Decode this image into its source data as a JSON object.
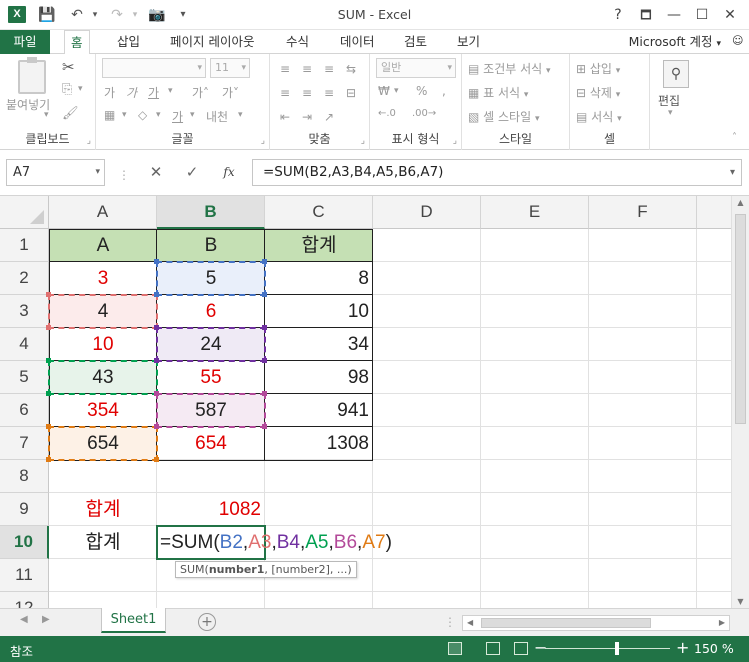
{
  "window": {
    "title": "SUM - Excel",
    "app_icon": "X",
    "help": "?",
    "restore_ribbon": "🗖",
    "minimize": "—",
    "maximize": "☐",
    "close": "✕"
  },
  "quick_access": {
    "save_icon": "save-icon",
    "undo_icon": "undo-icon",
    "redo_icon": "redo-icon",
    "camera_icon": "camera-icon",
    "customize": "▾"
  },
  "tabs": {
    "file": "파일",
    "home": "홈",
    "insert": "삽입",
    "page_layout": "페이지 레이아웃",
    "formulas": "수식",
    "data": "데이터",
    "review": "검토",
    "view": "보기",
    "account": "Microsoft 계정"
  },
  "ribbon": {
    "clipboard": {
      "label": "클립보드",
      "paste": "붙여넣기",
      "cut_icon": "scissors-icon",
      "copy_icon": "copy-icon",
      "format_painter_icon": "brush-icon"
    },
    "font": {
      "label": "글꼴",
      "font_name": "",
      "font_size": "11",
      "grow": "가˄",
      "shrink": "가˅",
      "bold": "가",
      "italic": "가",
      "underline": "가",
      "borders": "▦",
      "fill": "◇",
      "font_color": "가"
    },
    "alignment": {
      "label": "맞춤",
      "wrap": "내청",
      "align_marks": [
        "≡",
        "≡",
        "≡",
        "⇆"
      ]
    },
    "number": {
      "label": "표시 형식",
      "format": "일반",
      "currency": "₩",
      "percent": "%",
      "comma": ",",
      "inc_dec": ".00→.0",
      "dec_dec": ".0→.00"
    },
    "styles": {
      "label": "스타일",
      "conditional": "조건부 서식",
      "table": "표 서식",
      "cell": "셀 스타일"
    },
    "cells": {
      "label": "셀",
      "insert": "삽입",
      "delete": "삭제",
      "format": "서식"
    },
    "editing": {
      "label": "편집"
    }
  },
  "formula_bar": {
    "name_box": "A7",
    "cancel": "✕",
    "enter": "✓",
    "fx": "fx",
    "formula": "=SUM(B2,A3,B4,A5,B6,A7)"
  },
  "columns": [
    "A",
    "B",
    "C",
    "D",
    "E",
    "F"
  ],
  "rows": [
    "1",
    "2",
    "3",
    "4",
    "5",
    "6",
    "7",
    "8",
    "9",
    "10",
    "11",
    "12"
  ],
  "table": {
    "header": [
      "A",
      "B",
      "합계"
    ],
    "rows": [
      [
        "3",
        "5",
        "8"
      ],
      [
        "4",
        "6",
        "10"
      ],
      [
        "10",
        "24",
        "34"
      ],
      [
        "43",
        "55",
        "98"
      ],
      [
        "354",
        "587",
        "941"
      ],
      [
        "654",
        "654",
        "1308"
      ]
    ]
  },
  "row9": {
    "label": "합계",
    "value": "1082"
  },
  "row10": {
    "label": "합계",
    "formula_prefix": "=SUM(",
    "refs": [
      "B2",
      "A3",
      "B4",
      "A5",
      "B6",
      "A7"
    ],
    "separator": ",",
    "close": ")"
  },
  "tooltip": {
    "fn": "SUM(",
    "arg1": "number1",
    "rest": ", [number2], ...)"
  },
  "sheet": {
    "tab": "Sheet1",
    "add": "+",
    "nav_prev": "◀",
    "nav_next": "▶"
  },
  "status": {
    "mode": "참조",
    "zoom": "150 %",
    "zoom_minus": "−",
    "zoom_plus": "+"
  },
  "colors": {
    "excel_green": "#217346",
    "header_fill": "#c5e0b4",
    "red_text": "#e00000",
    "ref_colors": [
      "#4472c4",
      "#e00000",
      "#7030a0",
      "#00a050",
      "#b34a9a",
      "#e07b14"
    ]
  }
}
